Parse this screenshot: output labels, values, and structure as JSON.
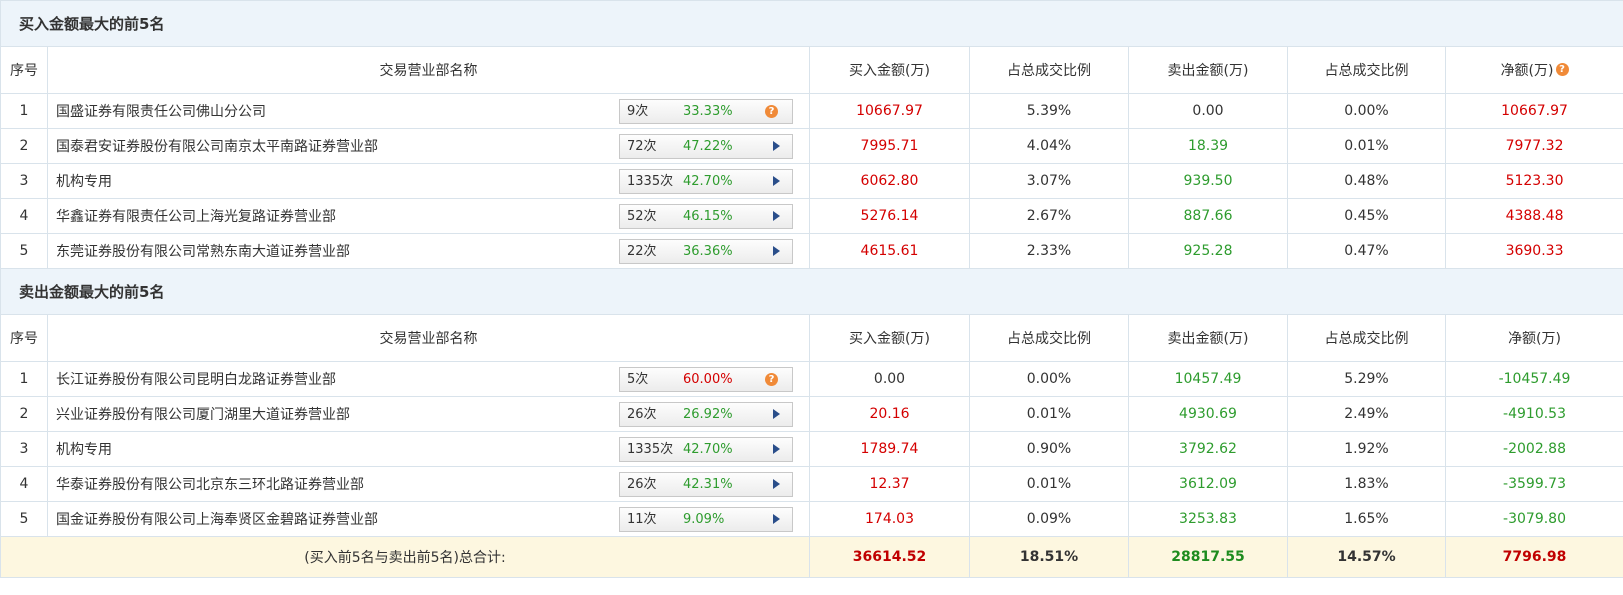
{
  "buy_section": {
    "title": "买入金额最大的前5名",
    "headers": [
      "序号",
      "交易营业部名称",
      "买入金额(万)",
      "占总成交比例",
      "卖出金额(万)",
      "占总成交比例",
      "净额(万)"
    ],
    "rows": [
      {
        "idx": "1",
        "name": "国盛证券有限责任公司佛山分公司",
        "count": "9次",
        "pct": "33.33%",
        "buy": "10667.97",
        "buy_ratio": "5.39%",
        "sell": "0.00",
        "sell_ratio": "0.00%",
        "net": "10667.97"
      },
      {
        "idx": "2",
        "name": "国泰君安证券股份有限公司南京太平南路证券营业部",
        "count": "72次",
        "pct": "47.22%",
        "buy": "7995.71",
        "buy_ratio": "4.04%",
        "sell": "18.39",
        "sell_ratio": "0.01%",
        "net": "7977.32"
      },
      {
        "idx": "3",
        "name": "机构专用",
        "count": "1335次",
        "pct": "42.70%",
        "buy": "6062.80",
        "buy_ratio": "3.07%",
        "sell": "939.50",
        "sell_ratio": "0.48%",
        "net": "5123.30"
      },
      {
        "idx": "4",
        "name": "华鑫证券有限责任公司上海光复路证券营业部",
        "count": "52次",
        "pct": "46.15%",
        "buy": "5276.14",
        "buy_ratio": "2.67%",
        "sell": "887.66",
        "sell_ratio": "0.45%",
        "net": "4388.48"
      },
      {
        "idx": "5",
        "name": "东莞证券股份有限公司常熟东南大道证券营业部",
        "count": "22次",
        "pct": "36.36%",
        "buy": "4615.61",
        "buy_ratio": "2.33%",
        "sell": "925.28",
        "sell_ratio": "0.47%",
        "net": "3690.33"
      }
    ]
  },
  "sell_section": {
    "title": "卖出金额最大的前5名",
    "headers": [
      "序号",
      "交易营业部名称",
      "买入金额(万)",
      "占总成交比例",
      "卖出金额(万)",
      "占总成交比例",
      "净额(万)"
    ],
    "rows": [
      {
        "idx": "1",
        "name": "长江证券股份有限公司昆明白龙路证券营业部",
        "count": "5次",
        "pct": "60.00%",
        "buy": "0.00",
        "buy_ratio": "0.00%",
        "sell": "10457.49",
        "sell_ratio": "5.29%",
        "net": "-10457.49"
      },
      {
        "idx": "2",
        "name": "兴业证券股份有限公司厦门湖里大道证券营业部",
        "count": "26次",
        "pct": "26.92%",
        "buy": "20.16",
        "buy_ratio": "0.01%",
        "sell": "4930.69",
        "sell_ratio": "2.49%",
        "net": "-4910.53"
      },
      {
        "idx": "3",
        "name": "机构专用",
        "count": "1335次",
        "pct": "42.70%",
        "buy": "1789.74",
        "buy_ratio": "0.90%",
        "sell": "3792.62",
        "sell_ratio": "1.92%",
        "net": "-2002.88"
      },
      {
        "idx": "4",
        "name": "华泰证券股份有限公司北京东三环北路证券营业部",
        "count": "26次",
        "pct": "42.31%",
        "buy": "12.37",
        "buy_ratio": "0.01%",
        "sell": "3612.09",
        "sell_ratio": "1.83%",
        "net": "-3599.73"
      },
      {
        "idx": "5",
        "name": "国金证券股份有限公司上海奉贤区金碧路证券营业部",
        "count": "11次",
        "pct": "9.09%",
        "buy": "174.03",
        "buy_ratio": "0.09%",
        "sell": "3253.83",
        "sell_ratio": "1.65%",
        "net": "-3079.80"
      }
    ]
  },
  "total": {
    "label": "(买入前5名与卖出前5名)总合计:",
    "buy": "36614.52",
    "buy_ratio": "18.51%",
    "sell": "28817.55",
    "sell_ratio": "14.57%",
    "net": "7796.98"
  },
  "icons": {
    "help": "question-icon",
    "expand": "play-triangle-icon",
    "help_glyph": "?"
  },
  "colors": {
    "header_bg": "#edf4fa",
    "positive": "#d40000",
    "negative": "#2e9c2e",
    "help_icon": "#f08a38",
    "arrow": "#2a4e8a",
    "total_bg": "#fdf7e0"
  }
}
